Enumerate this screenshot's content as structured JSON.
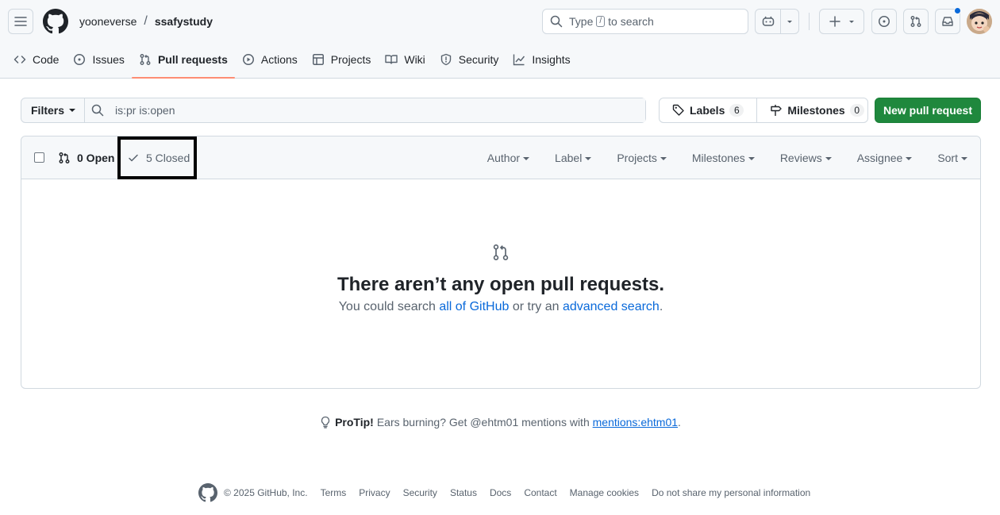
{
  "header": {
    "owner": "yooneverse",
    "separator": "/",
    "repo": "ssafystudy",
    "search_prefix": "Type",
    "search_key": "/",
    "search_suffix": "to search"
  },
  "repo_nav": [
    {
      "label": "Code",
      "icon": "code-icon"
    },
    {
      "label": "Issues",
      "icon": "issue-icon"
    },
    {
      "label": "Pull requests",
      "icon": "pull-request-icon",
      "selected": true
    },
    {
      "label": "Actions",
      "icon": "play-icon"
    },
    {
      "label": "Projects",
      "icon": "table-icon"
    },
    {
      "label": "Wiki",
      "icon": "book-icon"
    },
    {
      "label": "Security",
      "icon": "shield-icon"
    },
    {
      "label": "Insights",
      "icon": "graph-icon"
    }
  ],
  "filter_bar": {
    "filters_label": "Filters",
    "query": "is:pr is:open",
    "labels_label": "Labels",
    "labels_count": "6",
    "milestones_label": "Milestones",
    "milestones_count": "0",
    "new_pr_label": "New pull request"
  },
  "list_header": {
    "open_label": "0 Open",
    "closed_label": "5 Closed",
    "menus": [
      "Author",
      "Label",
      "Projects",
      "Milestones",
      "Reviews",
      "Assignee",
      "Sort"
    ]
  },
  "blankslate": {
    "title": "There aren’t any open pull requests.",
    "text_before": "You could search ",
    "link1": "all of GitHub",
    "text_middle": " or try an ",
    "link2": "advanced search",
    "text_after": "."
  },
  "protip": {
    "label": "ProTip!",
    "text": "Ears burning? Get @ehtm01 mentions with",
    "link": "mentions:ehtm01",
    "end": "."
  },
  "footer": {
    "copyright": "© 2025 GitHub, Inc.",
    "links": [
      "Terms",
      "Privacy",
      "Security",
      "Status",
      "Docs",
      "Contact",
      "Manage cookies",
      "Do not share my personal information"
    ]
  },
  "colors": {
    "accent": "#0969da",
    "primary_button": "#1f883d",
    "selected_tab_underline": "#fd8c73",
    "notification_dot": "#0969da"
  }
}
